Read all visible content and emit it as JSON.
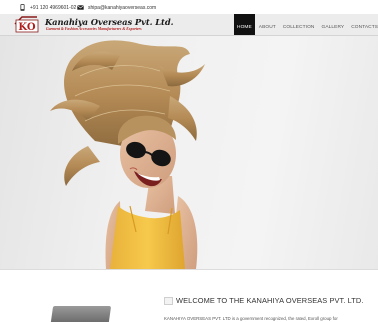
{
  "topbar": {
    "phone": "+91 120 4969601-02",
    "email": "shipa@kanahiyaoverseas.com"
  },
  "brand": {
    "logo_text": "KO",
    "name": "Kanahiya Overseas Pvt. Ltd.",
    "tagline": "Garment & Fashion Accessories Manufacturers & Exporters"
  },
  "nav": {
    "items": [
      {
        "label": "HOME",
        "active": true
      },
      {
        "label": "ABOUT",
        "active": false
      },
      {
        "label": "COLLECTION",
        "active": false
      },
      {
        "label": "GALLERY",
        "active": false
      },
      {
        "label": "CONTACTS",
        "active": false
      }
    ]
  },
  "hero": {
    "image": "woman-with-sunglasses-yellow-top"
  },
  "welcome": {
    "title": "WELCOME TO THE KANAHIYA OVERSEAS PVT. LTD.",
    "text": "KANAHIYA OVERSEAS PVT. LTD is a government recognized, the rated, Exroll group for"
  },
  "colors": {
    "nav_active_bg": "#111111",
    "tagline": "#b31b1b",
    "top_bg": "#ffffff",
    "header_bg": "#ececec",
    "shirt": "#f5c23e"
  },
  "icons": [
    "mobile-phone-icon",
    "envelope-icon"
  ]
}
